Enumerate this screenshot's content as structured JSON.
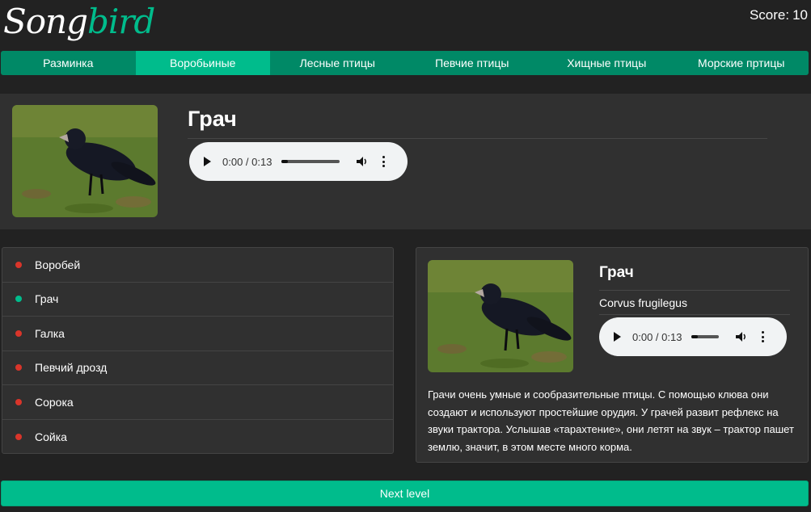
{
  "logo": {
    "part1": "Song",
    "part2": "bird"
  },
  "score": {
    "label": "Score:",
    "value": "10"
  },
  "nav": [
    {
      "label": "Разминка",
      "active": false
    },
    {
      "label": "Воробьиные",
      "active": true
    },
    {
      "label": "Лесные птицы",
      "active": false
    },
    {
      "label": "Певчие птицы",
      "active": false
    },
    {
      "label": "Хищные птицы",
      "active": false
    },
    {
      "label": "Морские пртицы",
      "active": false
    }
  ],
  "question": {
    "title": "Грач",
    "player": {
      "time": "0:00 / 0:13"
    }
  },
  "answers": [
    {
      "label": "Воробей",
      "status": "wrong"
    },
    {
      "label": "Грач",
      "status": "correct"
    },
    {
      "label": "Галка",
      "status": "wrong"
    },
    {
      "label": "Певчий дрозд",
      "status": "wrong"
    },
    {
      "label": "Сорока",
      "status": "wrong"
    },
    {
      "label": "Сойка",
      "status": "wrong"
    }
  ],
  "details": {
    "name": "Грач",
    "latin": "Corvus frugilegus",
    "player": {
      "time": "0:00 / 0:13"
    },
    "description": "Грачи очень умные и сообразительные птицы. С помощью клюва они создают и используют простейшие орудия. У грачей развит рефлекс на звуки трактора. Услышав «тарахтение», они летят на звук – трактор пашет землю, значит, в этом месте много корма."
  },
  "next_button": "Next level",
  "colors": {
    "accent": "#00bc8c",
    "nav_bg": "#008966",
    "correct": "#00bc8c",
    "wrong": "#d9352a"
  },
  "icons": {
    "play": "play-icon",
    "volume": "volume-icon",
    "menu": "more-vert-icon",
    "bird": "rook-photo"
  }
}
